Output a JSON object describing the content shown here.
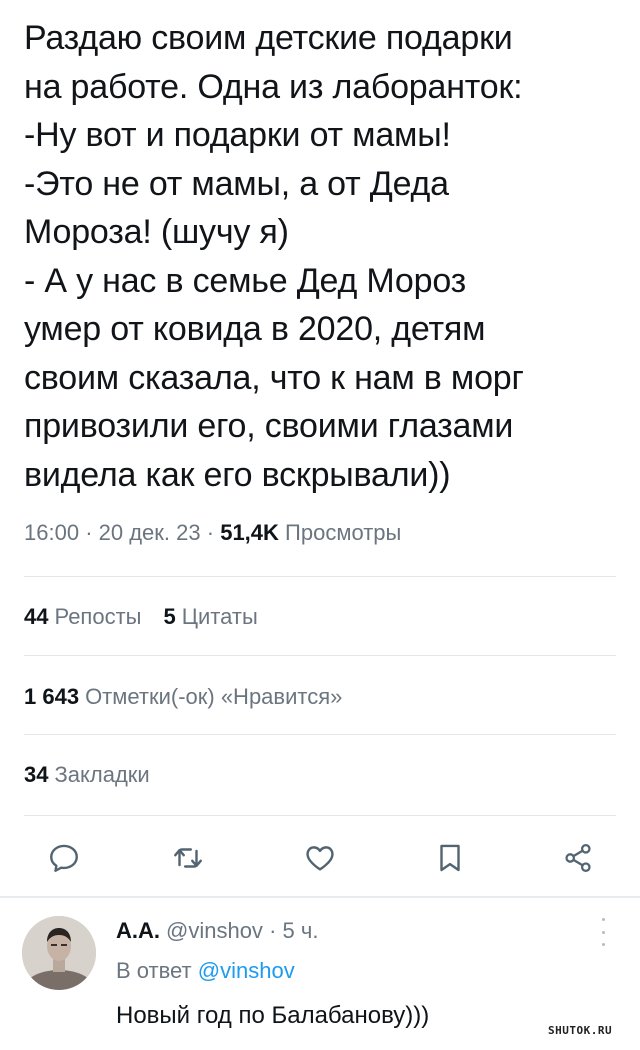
{
  "tweet": {
    "lines": [
      "Раздаю своим детские подарки",
      "на работе. Одна из лаборанток:",
      "-Ну вот и подарки от мамы!",
      "-Это не от мамы, а от Деда",
      "Мороза! (шучу я)",
      "- А у нас в семье Дед Мороз",
      "умер от ковида в 2020, детям",
      "своим сказала, что к нам в морг",
      "привозили его, своими глазами",
      "видела как его вскрывали))"
    ],
    "time": "16:00",
    "date": "20 дек. 23",
    "separator": "·",
    "views_count": "51,4K",
    "views_label": "Просмотры"
  },
  "stats": {
    "reposts_count": "44",
    "reposts_label": "Репосты",
    "quotes_count": "5",
    "quotes_label": "Цитаты",
    "likes_count": "1 643",
    "likes_label": "Отметки(-ок) «Нравится»",
    "bookmarks_count": "34",
    "bookmarks_label": "Закладки"
  },
  "actions": [
    "reply-icon",
    "retweet-icon",
    "like-icon",
    "bookmark-icon",
    "share-icon"
  ],
  "reply": {
    "author": "А.А.",
    "handle": "@vinshov",
    "separator": "·",
    "time": "5 ч.",
    "reply_to_prefix": "В ответ",
    "reply_to_handle": "@vinshov",
    "text": "Новый год по Балабанову)))"
  },
  "watermark": "SHUTOK.RU",
  "colors": {
    "text": "#0f1419",
    "muted": "#6b7580",
    "link": "#1d9bf0",
    "divider": "#e3e7ea"
  }
}
